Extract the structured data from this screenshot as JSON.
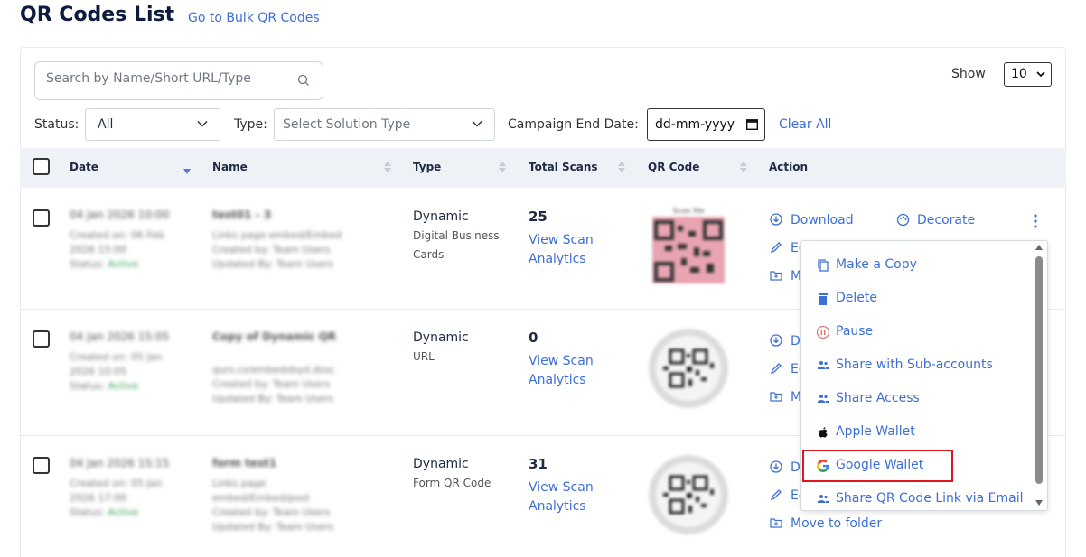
{
  "header": {
    "title": "QR Codes List",
    "bulk_link": "Go to Bulk QR Codes"
  },
  "search": {
    "placeholder": "Search by Name/Short URL/Type"
  },
  "show": {
    "label": "Show",
    "value": "10"
  },
  "filters": {
    "status_label": "Status:",
    "status_value": "All",
    "type_label": "Type:",
    "type_placeholder": "Select Solution Type",
    "end_date_label": "Campaign End Date:",
    "date_placeholder": "dd-mm-yyyy",
    "clear_all": "Clear All"
  },
  "table": {
    "columns": [
      "Date",
      "Name",
      "Type",
      "Total Scans",
      "QR Code",
      "Action"
    ],
    "rows": [
      {
        "date": "04 Jan 2026 10:00",
        "created": "Created on: 06 Feb",
        "created2": "2026 15:00",
        "status_label": "Status:",
        "status": "Active",
        "name": "test01 - 3",
        "name_sub1": "Links page embed/Embed",
        "name_sub2": "Created by: Team Users",
        "name_sub3": "Updated By: Team Users",
        "type": "Dynamic",
        "subtype": "Digital Business Cards",
        "scans": "25",
        "analytics": "View Scan Analytics"
      },
      {
        "date": "04 Jan 2026 15:05",
        "created": "Created on: 05 Jan",
        "created2": "2026 10:05",
        "status_label": "Status:",
        "status": "Active",
        "name": "Copy of Dynamic QR",
        "name_sub1": "qurs.cs/embedsbyd.dssc",
        "name_sub2": "Created by: Team Users",
        "name_sub3": "Updated By: Team Users",
        "type": "Dynamic",
        "subtype": "URL",
        "scans": "0",
        "analytics": "View Scan Analytics"
      },
      {
        "date": "04 Jan 2026 15:15",
        "created": "Created on: 05 Jan",
        "created2": "2026 17:00",
        "status_label": "Status:",
        "status": "Active",
        "name": "form test1",
        "name_sub1": "Links page embed/Embed/post",
        "name_sub2": "Created by: Team Users",
        "name_sub3": "Updated By: Team Users",
        "type": "Dynamic",
        "subtype": "Form QR Code",
        "scans": "31",
        "analytics": "View Scan Analytics"
      }
    ]
  },
  "actions": {
    "download": "Download",
    "decorate": "Decorate",
    "edit_partial": "Ed",
    "move_partial": "M",
    "download_partial": "Do",
    "edit_partial2": "Ed",
    "move_partial2": "M",
    "download_partial3": "Do",
    "edit_partial3": "Ed",
    "move_to_folder": "Move to folder"
  },
  "menu": {
    "items": [
      {
        "label": "Make a Copy",
        "icon": "copy-icon"
      },
      {
        "label": "Delete",
        "icon": "trash-icon"
      },
      {
        "label": "Pause",
        "icon": "pause-icon"
      },
      {
        "label": "Share with Sub-accounts",
        "icon": "users-icon"
      },
      {
        "label": "Share Access",
        "icon": "users-icon"
      },
      {
        "label": "Apple Wallet",
        "icon": "apple-icon"
      },
      {
        "label": "Google Wallet",
        "icon": "google-icon"
      },
      {
        "label": "Share QR Code Link via Email",
        "icon": "users-icon"
      }
    ]
  },
  "colors": {
    "accent": "#3d6fd6",
    "header_bg": "#eef1f6",
    "highlight": "#e0141b",
    "title": "#0d1b3e"
  }
}
